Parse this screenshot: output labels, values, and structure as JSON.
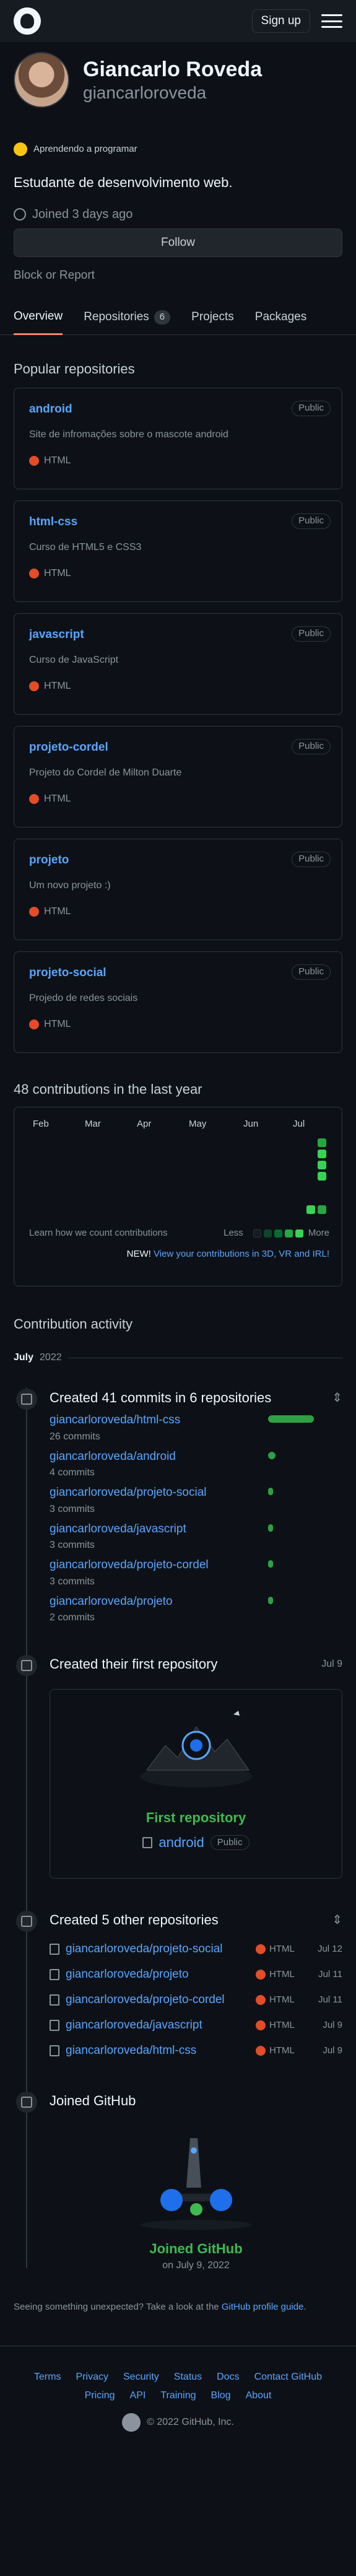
{
  "header": {
    "signup_label": "Sign up"
  },
  "profile": {
    "name": "Giancarlo Roveda",
    "login": "giancarloroveda",
    "status": "Aprendendo a programar",
    "bio": "Estudante de desenvolvimento web.",
    "joined": "Joined 3 days ago",
    "follow_label": "Follow",
    "block_label": "Block or Report"
  },
  "tabs": [
    {
      "label": "Overview"
    },
    {
      "label": "Repositories",
      "count": "6"
    },
    {
      "label": "Projects"
    },
    {
      "label": "Packages"
    }
  ],
  "popular": {
    "title": "Popular repositories",
    "repos": [
      {
        "name": "android",
        "visibility": "Public",
        "description": "Site de infromações sobre o mascote android",
        "language": "HTML"
      },
      {
        "name": "html-css",
        "visibility": "Public",
        "description": "Curso de HTML5 e CSS3",
        "language": "HTML"
      },
      {
        "name": "javascript",
        "visibility": "Public",
        "description": "Curso de JavaScript",
        "language": "HTML"
      },
      {
        "name": "projeto-cordel",
        "visibility": "Public",
        "description": "Projeto do Cordel de Milton Duarte",
        "language": "HTML"
      },
      {
        "name": "projeto",
        "visibility": "Public",
        "description": "Um novo projeto :)",
        "language": "HTML"
      },
      {
        "name": "projeto-social",
        "visibility": "Public",
        "description": "Projedo de redes sociais",
        "language": "HTML"
      }
    ]
  },
  "contributions": {
    "title": "48 contributions in the last year",
    "months": [
      "Feb",
      "Mar",
      "Apr",
      "May",
      "Jun",
      "Jul"
    ],
    "learn_label": "Learn how we count contributions",
    "less_label": "Less",
    "more_label": "More",
    "new_label": "NEW!",
    "new_link": "View your contributions in 3D, VR and IRL!",
    "colors": [
      "#161b22",
      "#0e4429",
      "#006d32",
      "#26a641",
      "#39d353"
    ]
  },
  "activity": {
    "title": "Contribution activity",
    "month": "July",
    "year": "2022",
    "commits_title": "Created 41 commits in 6 repositories",
    "commits": [
      {
        "repo": "giancarloroveda/html-css",
        "count": "26 commits",
        "share": 0.63
      },
      {
        "repo": "giancarloroveda/android",
        "count": "4 commits",
        "share": 0.1
      },
      {
        "repo": "giancarloroveda/projeto-social",
        "count": "3 commits",
        "share": 0.07
      },
      {
        "repo": "giancarloroveda/javascript",
        "count": "3 commits",
        "share": 0.07
      },
      {
        "repo": "giancarloroveda/projeto-cordel",
        "count": "3 commits",
        "share": 0.07
      },
      {
        "repo": "giancarloroveda/projeto",
        "count": "2 commits",
        "share": 0.05
      }
    ],
    "first_repo_title": "Created their first repository",
    "first_repo_date": "Jul 9",
    "first_repo_label": "First repository",
    "first_repo_name": "android",
    "first_repo_visibility": "Public",
    "other_title": "Created 5 other repositories",
    "other_repos": [
      {
        "repo": "giancarloroveda/projeto-social",
        "language": "HTML",
        "date": "Jul 12"
      },
      {
        "repo": "giancarloroveda/projeto",
        "language": "HTML",
        "date": "Jul 11"
      },
      {
        "repo": "giancarloroveda/projeto-cordel",
        "language": "HTML",
        "date": "Jul 11"
      },
      {
        "repo": "giancarloroveda/javascript",
        "language": "HTML",
        "date": "Jul 9"
      },
      {
        "repo": "giancarloroveda/html-css",
        "language": "HTML",
        "date": "Jul 9"
      }
    ],
    "joined_title": "Joined GitHub",
    "joined_label": "Joined GitHub",
    "joined_date": "on July 9, 2022"
  },
  "feedback": {
    "text": "Seeing something unexpected? Take a look at the",
    "link": "GitHub profile guide",
    "end": "."
  },
  "footer": {
    "links": [
      "Terms",
      "Privacy",
      "Security",
      "Status",
      "Docs",
      "Contact GitHub",
      "Pricing",
      "API",
      "Training",
      "Blog",
      "About"
    ],
    "copyright": "© 2022 GitHub, Inc."
  }
}
